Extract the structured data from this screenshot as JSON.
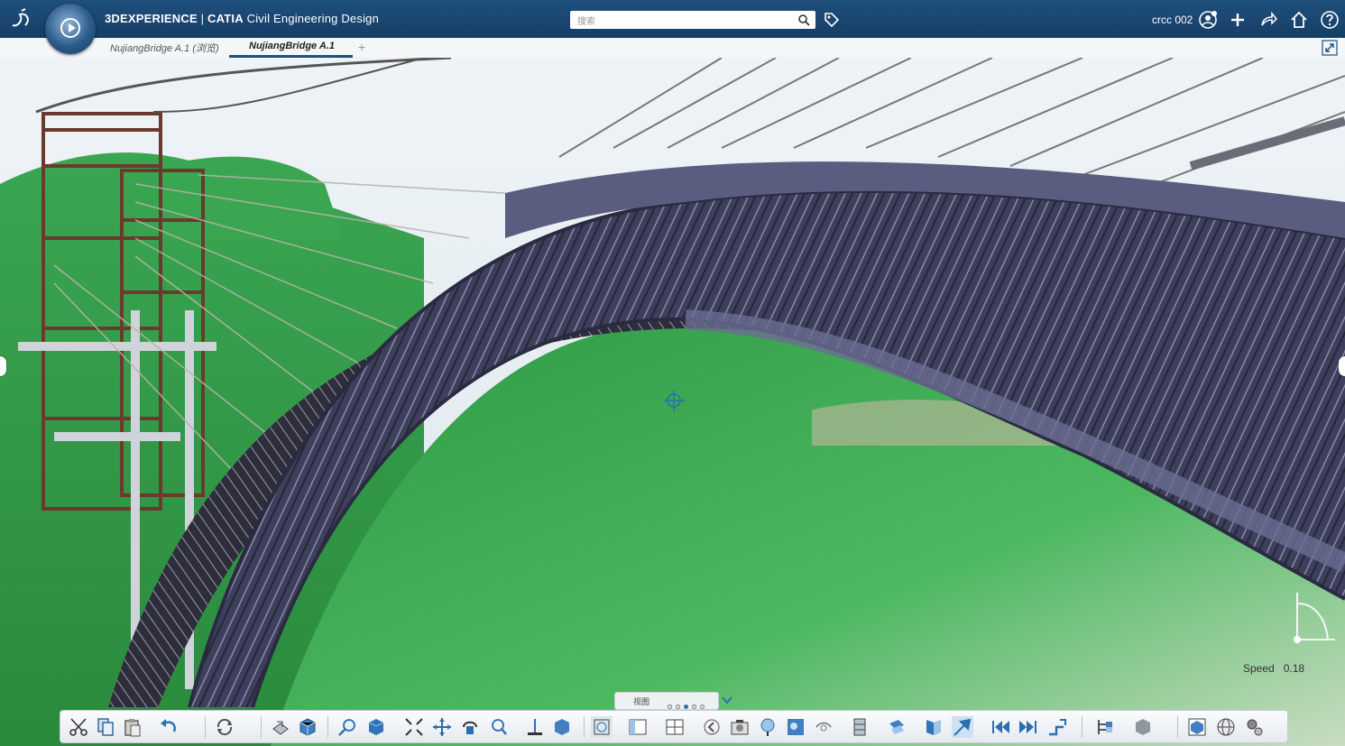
{
  "header": {
    "app_brand": "3DEXPERIENCE",
    "separator": " | ",
    "app_product": "CATIA",
    "app_name": " Civil Engineering Design",
    "search_placeholder": "搜索",
    "username": "crcc 002"
  },
  "tabs": [
    {
      "label": "NujiangBridge A.1 (浏览)",
      "active": false
    },
    {
      "label": "NujiangBridge A.1",
      "active": true
    }
  ],
  "tab_add_label": "+",
  "viewport": {
    "speed_label": "Speed",
    "speed_value": "0.18"
  },
  "view_selector": {
    "label": "视图",
    "page_count": 5,
    "active_page": 3
  },
  "colors": {
    "header_bg": "#1f4f7c",
    "bridge": "#4a4c6e",
    "terrain": "#3fa653",
    "sky": "#dfeaf0"
  },
  "toolbar_icons": [
    "cut-icon",
    "copy-icon",
    "paste-icon",
    "undo-icon",
    "update-icon",
    "catalog-icon",
    "product-icon",
    "zoom-icon",
    "view-cube-icon",
    "fit-all-icon",
    "pan-icon",
    "rotate-icon",
    "zoom-in-out-icon",
    "normal-view-icon",
    "iso-view-icon",
    "render-style-icon",
    "layout-icon",
    "multi-view-icon",
    "previous-icon",
    "capture-icon",
    "look-at-icon",
    "ambience-icon",
    "clipping-icon",
    "explode-icon",
    "section-icon",
    "measure-icon",
    "fly-icon",
    "first-frame-icon",
    "last-frame-icon",
    "step-icon",
    "tree-icon",
    "cube-settings-icon",
    "render-icon",
    "globe-icon",
    "options-icon"
  ]
}
